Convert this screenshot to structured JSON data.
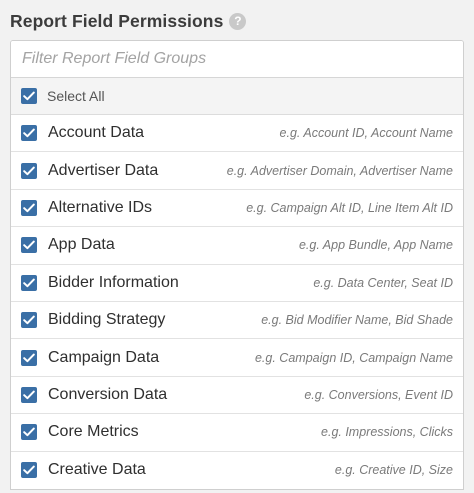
{
  "header": {
    "title": "Report Field Permissions",
    "help_glyph": "?"
  },
  "filter": {
    "placeholder": "Filter Report Field Groups",
    "value": ""
  },
  "select_all": {
    "label": "Select All",
    "checked": true
  },
  "colors": {
    "checkbox": "#3a6fa6",
    "help_icon": "#c9c9c9"
  },
  "groups": [
    {
      "label": "Account Data",
      "example": "e.g. Account ID, Account Name",
      "checked": true
    },
    {
      "label": "Advertiser Data",
      "example": "e.g. Advertiser Domain, Advertiser Name",
      "checked": true
    },
    {
      "label": "Alternative IDs",
      "example": "e.g. Campaign Alt ID, Line Item Alt ID",
      "checked": true
    },
    {
      "label": "App Data",
      "example": "e.g. App Bundle, App Name",
      "checked": true
    },
    {
      "label": "Bidder Information",
      "example": "e.g. Data Center, Seat ID",
      "checked": true
    },
    {
      "label": "Bidding Strategy",
      "example": "e.g. Bid Modifier Name, Bid Shade",
      "checked": true
    },
    {
      "label": "Campaign Data",
      "example": "e.g. Campaign ID, Campaign Name",
      "checked": true
    },
    {
      "label": "Conversion Data",
      "example": "e.g. Conversions, Event ID",
      "checked": true
    },
    {
      "label": "Core Metrics",
      "example": "e.g. Impressions, Clicks",
      "checked": true
    },
    {
      "label": "Creative Data",
      "example": "e.g. Creative ID, Size",
      "checked": true
    }
  ]
}
